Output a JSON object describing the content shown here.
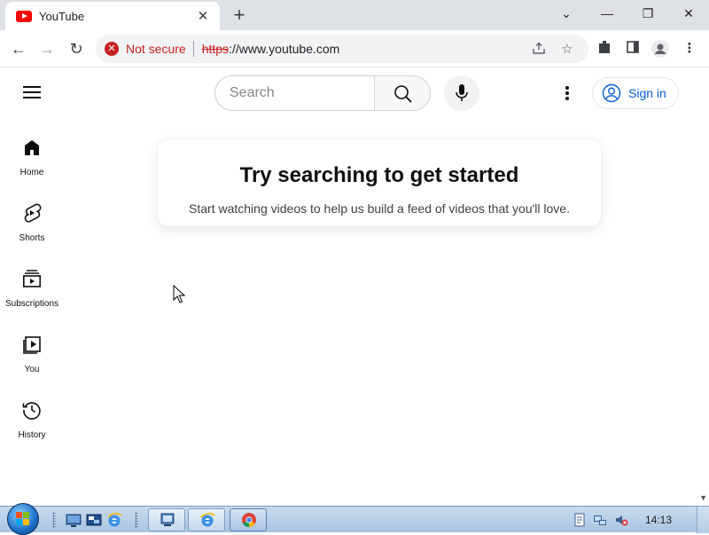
{
  "browser": {
    "tab_title": "YouTube",
    "tab_close": "✕",
    "new_tab": "+",
    "window_controls": {
      "dropdown": "⌄",
      "minimize": "—",
      "restore": "❐",
      "close": "✕"
    },
    "nav": {
      "back": "←",
      "forward": "→",
      "reload": "↻"
    },
    "security_label": "Not secure",
    "url_scheme": "https",
    "url_rest": "://www.youtube.com",
    "colors": {
      "tab_strip": "#dee1e6",
      "not_secure": "#c5221f"
    }
  },
  "youtube": {
    "search_placeholder": "Search",
    "sign_in": "Sign in",
    "sidebar": [
      {
        "label": "Home",
        "icon": "home-icon"
      },
      {
        "label": "Shorts",
        "icon": "shorts-icon"
      },
      {
        "label": "Subscriptions",
        "icon": "subscriptions-icon"
      },
      {
        "label": "You",
        "icon": "you-icon"
      },
      {
        "label": "History",
        "icon": "history-icon"
      }
    ],
    "prompt_title": "Try searching to get started",
    "prompt_subtitle": "Start watching videos to help us build a feed of videos that you'll love.",
    "colors": {
      "accent": "#065fd4",
      "brand": "#ff0000"
    }
  },
  "taskbar": {
    "clock": "14:13"
  }
}
